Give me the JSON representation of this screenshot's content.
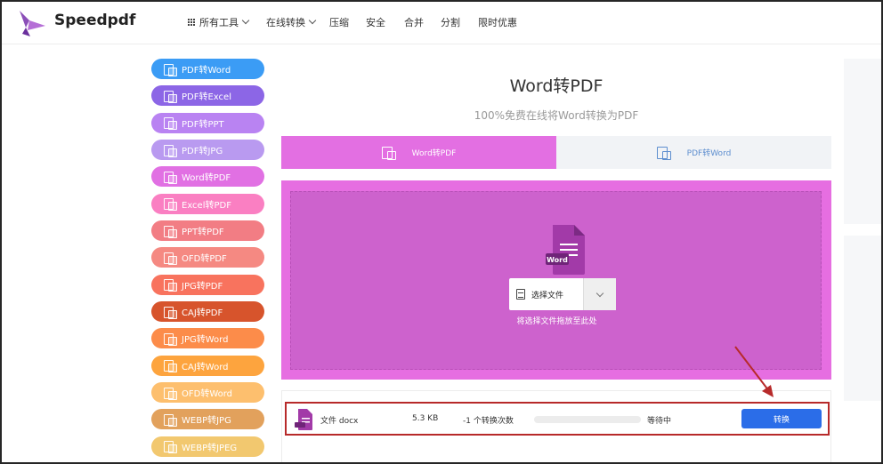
{
  "brand": {
    "name": "Speedpdf"
  },
  "nav": [
    {
      "label": "所有工具",
      "has_grid_icon": true,
      "has_dropdown": true
    },
    {
      "label": "在线转换",
      "has_grid_icon": false,
      "has_dropdown": true
    },
    {
      "label": "压缩",
      "has_grid_icon": false,
      "has_dropdown": false
    },
    {
      "label": "安全",
      "has_grid_icon": false,
      "has_dropdown": false
    },
    {
      "label": "合并",
      "has_grid_icon": false,
      "has_dropdown": false
    },
    {
      "label": "分割",
      "has_grid_icon": false,
      "has_dropdown": false
    },
    {
      "label": "限时优惠",
      "has_grid_icon": false,
      "has_dropdown": false
    }
  ],
  "sidebar": {
    "items": [
      {
        "label": "PDF转Word",
        "color": "#3b9cf5"
      },
      {
        "label": "PDF转Excel",
        "color": "#8c66e6"
      },
      {
        "label": "PDF转PPT",
        "color": "#b983f2"
      },
      {
        "label": "PDF转JPG",
        "color": "#b99af0"
      },
      {
        "label": "Word转PDF",
        "color": "#e170e3"
      },
      {
        "label": "Excel转PDF",
        "color": "#fa7fc2"
      },
      {
        "label": "PPT转PDF",
        "color": "#f27d84"
      },
      {
        "label": "OFD转PDF",
        "color": "#f58982"
      },
      {
        "label": "JPG转PDF",
        "color": "#f8735e"
      },
      {
        "label": "CAJ转PDF",
        "color": "#d7542c"
      },
      {
        "label": "JPG转Word",
        "color": "#fc8c4a"
      },
      {
        "label": "CAJ转Word",
        "color": "#fda43e"
      },
      {
        "label": "OFD转Word",
        "color": "#fdbf6e"
      },
      {
        "label": "WEBP转JPG",
        "color": "#e2a15c"
      },
      {
        "label": "WEBP转JPEG",
        "color": "#f2c86f"
      }
    ]
  },
  "main": {
    "title": "Word转PDF",
    "subtitle": "100%免费在线将Word转换为PDF",
    "tabs": [
      {
        "label": "Word转PDF",
        "active": true
      },
      {
        "label": "PDF转Word",
        "active": false
      }
    ],
    "upload": {
      "file_type_label": "Word",
      "select_label": "选择文件",
      "hint": "将选择文件拖放至此处"
    }
  },
  "file": {
    "name": "文件 docx",
    "size": "5.3 KB",
    "count": "-1 个转换次数",
    "progress": 0,
    "status": "等待中",
    "action": "转换"
  },
  "colors": {
    "accent": "#e36fe2",
    "dropzone": "#e66ee1",
    "dropzone_inner": "#cd62cd",
    "primary_button": "#2b6de8",
    "highlight_box": "#b72a2a"
  }
}
